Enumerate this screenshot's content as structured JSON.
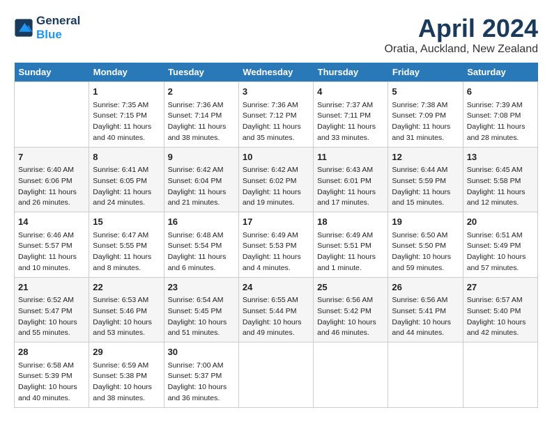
{
  "header": {
    "logo_line1": "General",
    "logo_line2": "Blue",
    "month": "April 2024",
    "location": "Oratia, Auckland, New Zealand"
  },
  "days": [
    "Sunday",
    "Monday",
    "Tuesday",
    "Wednesday",
    "Thursday",
    "Friday",
    "Saturday"
  ],
  "weeks": [
    [
      {
        "day": "",
        "info": ""
      },
      {
        "day": "1",
        "info": "Sunrise: 7:35 AM\nSunset: 7:15 PM\nDaylight: 11 hours\nand 40 minutes."
      },
      {
        "day": "2",
        "info": "Sunrise: 7:36 AM\nSunset: 7:14 PM\nDaylight: 11 hours\nand 38 minutes."
      },
      {
        "day": "3",
        "info": "Sunrise: 7:36 AM\nSunset: 7:12 PM\nDaylight: 11 hours\nand 35 minutes."
      },
      {
        "day": "4",
        "info": "Sunrise: 7:37 AM\nSunset: 7:11 PM\nDaylight: 11 hours\nand 33 minutes."
      },
      {
        "day": "5",
        "info": "Sunrise: 7:38 AM\nSunset: 7:09 PM\nDaylight: 11 hours\nand 31 minutes."
      },
      {
        "day": "6",
        "info": "Sunrise: 7:39 AM\nSunset: 7:08 PM\nDaylight: 11 hours\nand 28 minutes."
      }
    ],
    [
      {
        "day": "7",
        "info": "Sunrise: 6:40 AM\nSunset: 6:06 PM\nDaylight: 11 hours\nand 26 minutes."
      },
      {
        "day": "8",
        "info": "Sunrise: 6:41 AM\nSunset: 6:05 PM\nDaylight: 11 hours\nand 24 minutes."
      },
      {
        "day": "9",
        "info": "Sunrise: 6:42 AM\nSunset: 6:04 PM\nDaylight: 11 hours\nand 21 minutes."
      },
      {
        "day": "10",
        "info": "Sunrise: 6:42 AM\nSunset: 6:02 PM\nDaylight: 11 hours\nand 19 minutes."
      },
      {
        "day": "11",
        "info": "Sunrise: 6:43 AM\nSunset: 6:01 PM\nDaylight: 11 hours\nand 17 minutes."
      },
      {
        "day": "12",
        "info": "Sunrise: 6:44 AM\nSunset: 5:59 PM\nDaylight: 11 hours\nand 15 minutes."
      },
      {
        "day": "13",
        "info": "Sunrise: 6:45 AM\nSunset: 5:58 PM\nDaylight: 11 hours\nand 12 minutes."
      }
    ],
    [
      {
        "day": "14",
        "info": "Sunrise: 6:46 AM\nSunset: 5:57 PM\nDaylight: 11 hours\nand 10 minutes."
      },
      {
        "day": "15",
        "info": "Sunrise: 6:47 AM\nSunset: 5:55 PM\nDaylight: 11 hours\nand 8 minutes."
      },
      {
        "day": "16",
        "info": "Sunrise: 6:48 AM\nSunset: 5:54 PM\nDaylight: 11 hours\nand 6 minutes."
      },
      {
        "day": "17",
        "info": "Sunrise: 6:49 AM\nSunset: 5:53 PM\nDaylight: 11 hours\nand 4 minutes."
      },
      {
        "day": "18",
        "info": "Sunrise: 6:49 AM\nSunset: 5:51 PM\nDaylight: 11 hours\nand 1 minute."
      },
      {
        "day": "19",
        "info": "Sunrise: 6:50 AM\nSunset: 5:50 PM\nDaylight: 10 hours\nand 59 minutes."
      },
      {
        "day": "20",
        "info": "Sunrise: 6:51 AM\nSunset: 5:49 PM\nDaylight: 10 hours\nand 57 minutes."
      }
    ],
    [
      {
        "day": "21",
        "info": "Sunrise: 6:52 AM\nSunset: 5:47 PM\nDaylight: 10 hours\nand 55 minutes."
      },
      {
        "day": "22",
        "info": "Sunrise: 6:53 AM\nSunset: 5:46 PM\nDaylight: 10 hours\nand 53 minutes."
      },
      {
        "day": "23",
        "info": "Sunrise: 6:54 AM\nSunset: 5:45 PM\nDaylight: 10 hours\nand 51 minutes."
      },
      {
        "day": "24",
        "info": "Sunrise: 6:55 AM\nSunset: 5:44 PM\nDaylight: 10 hours\nand 49 minutes."
      },
      {
        "day": "25",
        "info": "Sunrise: 6:56 AM\nSunset: 5:42 PM\nDaylight: 10 hours\nand 46 minutes."
      },
      {
        "day": "26",
        "info": "Sunrise: 6:56 AM\nSunset: 5:41 PM\nDaylight: 10 hours\nand 44 minutes."
      },
      {
        "day": "27",
        "info": "Sunrise: 6:57 AM\nSunset: 5:40 PM\nDaylight: 10 hours\nand 42 minutes."
      }
    ],
    [
      {
        "day": "28",
        "info": "Sunrise: 6:58 AM\nSunset: 5:39 PM\nDaylight: 10 hours\nand 40 minutes."
      },
      {
        "day": "29",
        "info": "Sunrise: 6:59 AM\nSunset: 5:38 PM\nDaylight: 10 hours\nand 38 minutes."
      },
      {
        "day": "30",
        "info": "Sunrise: 7:00 AM\nSunset: 5:37 PM\nDaylight: 10 hours\nand 36 minutes."
      },
      {
        "day": "",
        "info": ""
      },
      {
        "day": "",
        "info": ""
      },
      {
        "day": "",
        "info": ""
      },
      {
        "day": "",
        "info": ""
      }
    ]
  ]
}
